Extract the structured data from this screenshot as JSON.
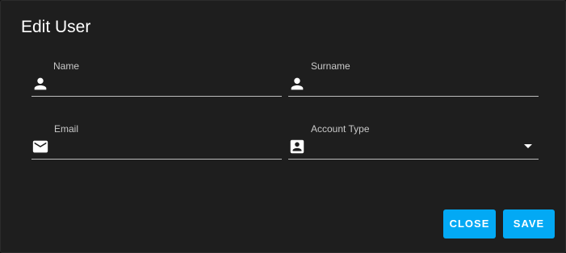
{
  "dialog": {
    "title": "Edit User"
  },
  "fields": {
    "name": {
      "label": "Name",
      "value": "",
      "icon": "person-icon"
    },
    "surname": {
      "label": "Surname",
      "value": "",
      "icon": "person-icon"
    },
    "email": {
      "label": "Email",
      "value": "",
      "icon": "mail-icon"
    },
    "account_type": {
      "label": "Account Type",
      "value": "",
      "icon": "account-box-icon"
    }
  },
  "actions": {
    "close_label": "CLOSE",
    "save_label": "SAVE"
  },
  "colors": {
    "background": "#1e1e1e",
    "accent": "#03a9f4",
    "text": "#ffffff",
    "label": "#c9c9c9",
    "underline": "#bdbdbd"
  }
}
